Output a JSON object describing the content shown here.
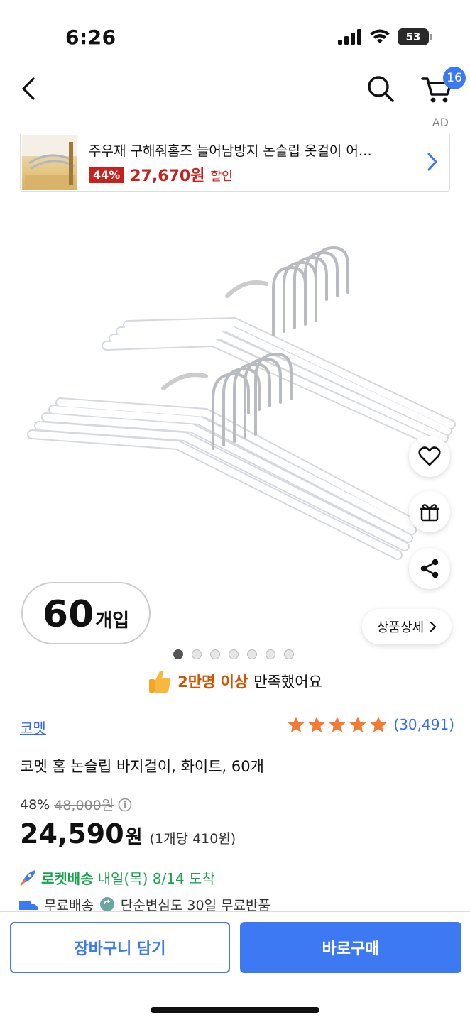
{
  "status_bar": {
    "time": "6:26",
    "battery": "53"
  },
  "nav": {
    "cart_count": "16",
    "ad_label": "AD"
  },
  "ad": {
    "title": "주우재 구해줘홈즈 늘어남방지 논슬립 옷걸이 어…",
    "discount": "44%",
    "price": "27,670원",
    "sale_label": "할인"
  },
  "product_image": {
    "quantity_number": "60",
    "quantity_unit": "개입",
    "detail_button": "상품상세",
    "page_count": 7,
    "active_page": 1
  },
  "satisfaction": {
    "highlight": "2만명 이상",
    "text": "만족했어요"
  },
  "product": {
    "brand": "코멧",
    "rating": 5,
    "review_count": "(30,491)",
    "title": "코멧 홈 논슬립 바지걸이, 화이트, 60개"
  },
  "price": {
    "discount": "48%",
    "original": "48,000원",
    "final": "24,590",
    "final_unit": "원",
    "unit_price": "(1개당 410원)"
  },
  "delivery": {
    "rocket": "로켓배송",
    "date": "내일(목) 8/14 도착",
    "free_shipping": "무료배송",
    "free_return": "단순변심도 30일 무료반품"
  },
  "bottom": {
    "cart_button": "장바구니 담기",
    "buy_button": "바로구매"
  },
  "colors": {
    "accent": "#3d79f2",
    "sale": "#c8201d",
    "rocket": "#17a34a",
    "star": "#f27a35"
  }
}
